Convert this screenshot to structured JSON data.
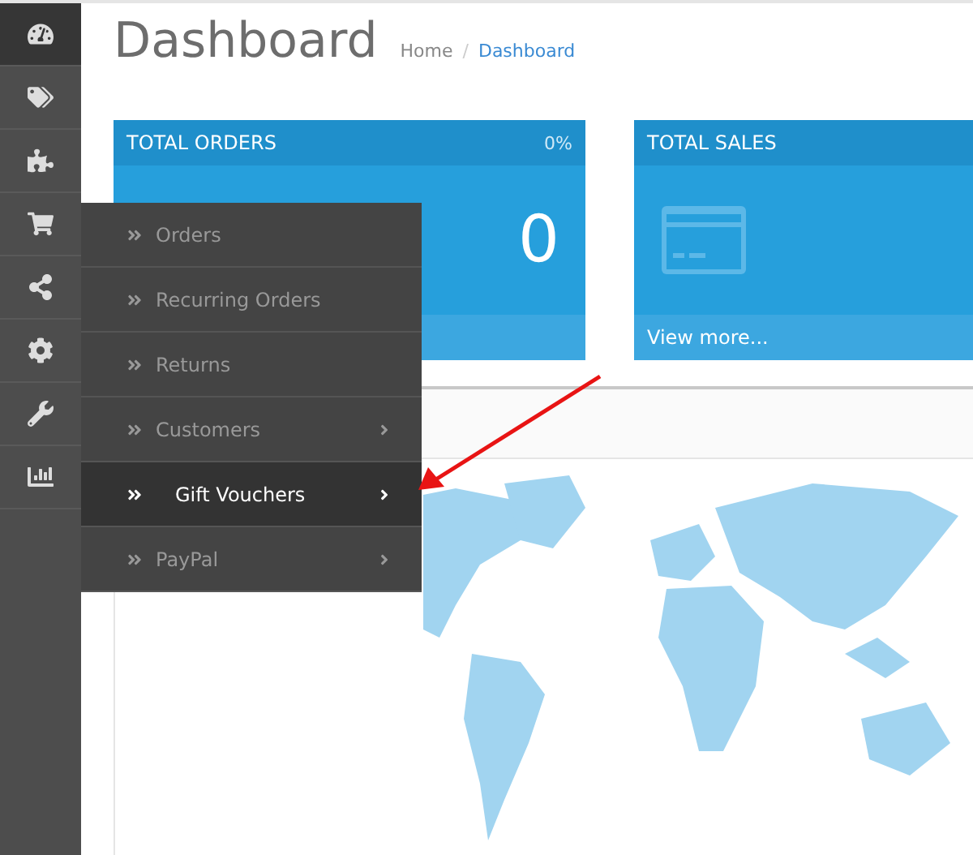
{
  "sidebar": {
    "items": [
      {
        "selected": true
      },
      {
        "selected": false
      },
      {
        "selected": false
      },
      {
        "selected": false
      },
      {
        "selected": false
      },
      {
        "selected": false
      },
      {
        "selected": false
      },
      {
        "selected": false
      }
    ]
  },
  "page": {
    "title": "Dashboard",
    "breadcrumb": [
      "Home",
      "Dashboard"
    ],
    "breadcrumb_separator": "/"
  },
  "cards": [
    {
      "title": "TOTAL ORDERS",
      "percent": "0%",
      "value": "0",
      "kind": "value"
    },
    {
      "title": "TOTAL SALES",
      "footer": "View more...",
      "kind": "icon"
    }
  ],
  "submenu": {
    "items": [
      {
        "label": "Orders",
        "has_children": false,
        "selected": false
      },
      {
        "label": "Recurring Orders",
        "has_children": false,
        "selected": false
      },
      {
        "label": "Returns",
        "has_children": false,
        "selected": false
      },
      {
        "label": "Customers",
        "has_children": true,
        "selected": false
      },
      {
        "label": "Gift Vouchers",
        "has_children": true,
        "selected": true
      },
      {
        "label": "PayPal",
        "has_children": true,
        "selected": false
      }
    ]
  }
}
